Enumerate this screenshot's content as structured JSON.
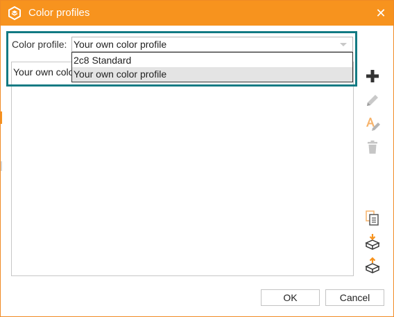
{
  "window": {
    "title": "Color profiles",
    "close_glyph": "✕",
    "accent": "#f7931e"
  },
  "profile": {
    "label": "Color profile:",
    "selected": "Your own color profile"
  },
  "dropdown": {
    "options": [
      "2c8 Standard",
      "Your own color profile"
    ],
    "highlighted": "Your own color profile"
  },
  "list": {
    "items": [
      "Your own color profile"
    ]
  },
  "toolbar": {
    "icons": [
      "add-icon",
      "edit-icon",
      "rename-icon",
      "delete-icon",
      "copy-icon",
      "import-icon",
      "export-icon"
    ]
  },
  "buttons": {
    "ok": "OK",
    "cancel": "Cancel"
  },
  "highlight_color": "#127a83"
}
